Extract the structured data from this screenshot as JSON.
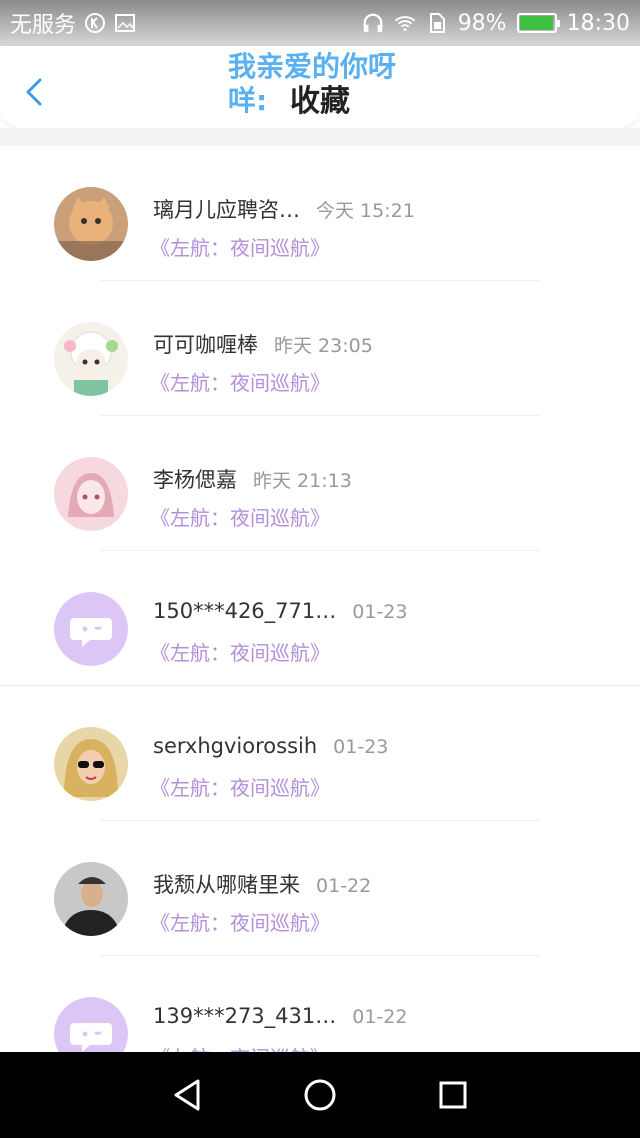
{
  "status_bar": {
    "carrier": "无服务",
    "battery": "98%",
    "battery_level": 0.98,
    "time": "18:30"
  },
  "header": {
    "overlay_text": "我亲爱的你呀 咩:",
    "title": "收藏"
  },
  "favorites": [
    {
      "name": "璃月儿应聘咨…",
      "time": "今天 15:21",
      "source": "《左航：夜间巡航》",
      "avatar": "cat-photo"
    },
    {
      "name": "可可咖喱棒",
      "time": "昨天 23:05",
      "source": "《左航：夜间巡航》",
      "avatar": "sheep-cartoon"
    },
    {
      "name": "李杨偲嘉",
      "time": "昨天 21:13",
      "source": "《左航：夜间巡航》",
      "avatar": "anime-girl"
    },
    {
      "name": "150***426_771…",
      "time": "01-23",
      "source": "《左航：夜间巡航》",
      "avatar": "default-chat"
    },
    {
      "name": "serxhgviorossih",
      "time": "01-23",
      "source": "《左航：夜间巡航》",
      "avatar": "girl-sunglasses"
    },
    {
      "name": "我颓从哪赌里来",
      "time": "01-22",
      "source": "《左航：夜间巡航》",
      "avatar": "man-hat"
    },
    {
      "name": "139***273_431…",
      "time": "01-22",
      "source": "《左航：夜间巡航》",
      "avatar": "default-chat"
    }
  ],
  "colors": {
    "accent": "#4aa8f0",
    "source_text": "#b48fd9",
    "default_avatar": "#dcc6f5"
  }
}
